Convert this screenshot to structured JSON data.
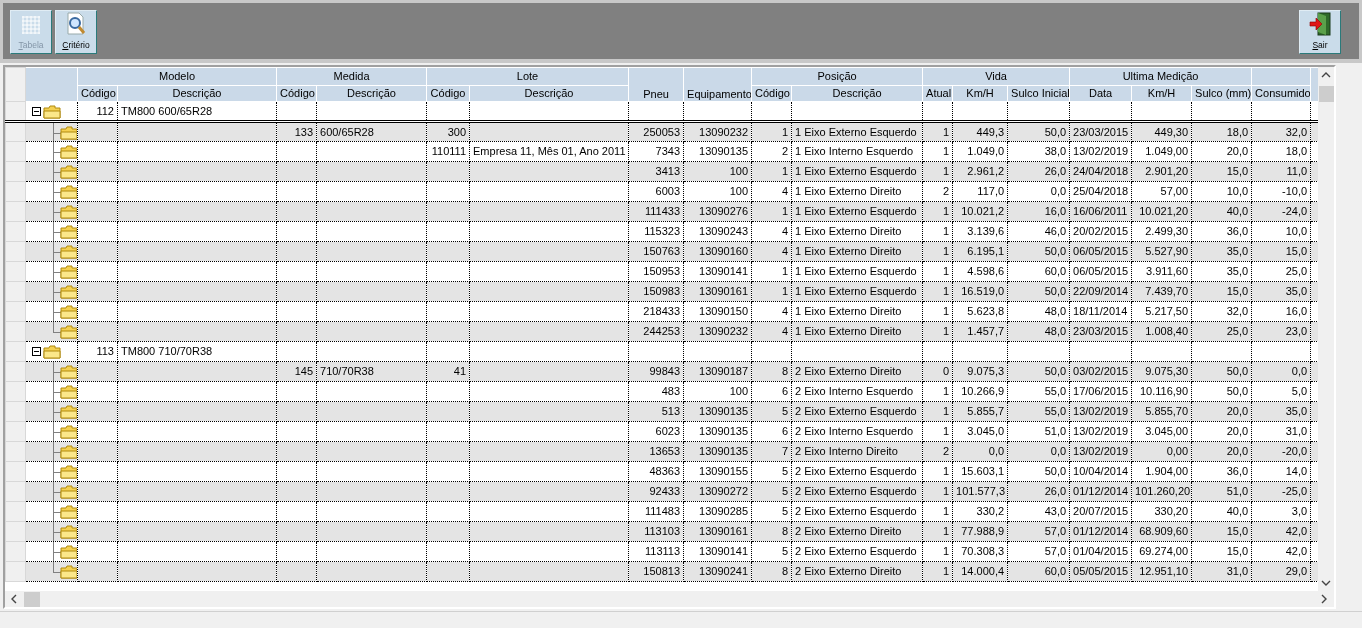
{
  "toolbar": {
    "buttons": [
      {
        "kind": "table",
        "label": "Tabela",
        "disabled": true
      },
      {
        "kind": "criteria",
        "label": "Critério",
        "disabled": false
      }
    ],
    "exit_button": {
      "label": "Sair"
    }
  },
  "table": {
    "header": [
      {
        "kind": "group",
        "label": "Modelo",
        "columns": [
          "Código",
          "Descrição"
        ]
      },
      {
        "kind": "group",
        "label": "Medida",
        "columns": [
          "Código",
          "Descrição"
        ]
      },
      {
        "kind": "group",
        "label": "Lote",
        "columns": [
          "Código",
          "Descrição"
        ]
      },
      {
        "kind": "single",
        "columns": [
          "Pneu"
        ]
      },
      {
        "kind": "single",
        "columns": [
          "Equipamento"
        ]
      },
      {
        "kind": "group",
        "label": "Posição",
        "columns": [
          "Código",
          "Descrição"
        ]
      },
      {
        "kind": "group",
        "label": "Vida",
        "columns": [
          "Atual",
          "Km/H",
          "Sulco Inicial"
        ]
      },
      {
        "kind": "group",
        "label": "Ultima Medição",
        "columns": [
          "Data",
          "Km/H",
          "Sulco (mm)"
        ]
      },
      {
        "kind": "group",
        "columns": [
          "Consumido"
        ]
      }
    ],
    "groups": [
      {
        "modelo_codigo": "112",
        "modelo_descricao": "TM800 600/65R28",
        "expanded": true,
        "current": true,
        "children": [
          {
            "medida_codigo": "133",
            "medida_descricao": "600/65R28",
            "lote_codigo": "300",
            "values": [
              "250053",
              "13090232",
              "1",
              "1 Eixo Externo Esquerdo",
              "1",
              "449,3",
              "50,0",
              "23/03/2015",
              "449,30",
              "18,0",
              "32,0"
            ]
          },
          {
            "lote_codigo": "110111",
            "lote_descricao": "Empresa 11, Mês 01, Ano 2011",
            "values": [
              "7343",
              "13090135",
              "2",
              "1 Eixo Interno Esquerdo",
              "1",
              "1.049,0",
              "38,0",
              "13/02/2019",
              "1.049,00",
              "20,0",
              "18,0"
            ]
          },
          {
            "values": [
              "3413",
              "100",
              "1",
              "1 Eixo Externo Esquerdo",
              "1",
              "2.961,2",
              "26,0",
              "24/04/2018",
              "2.901,20",
              "15,0",
              "11,0"
            ]
          },
          {
            "values": [
              "6003",
              "100",
              "4",
              "1 Eixo Externo Direito",
              "2",
              "117,0",
              "0,0",
              "25/04/2018",
              "57,00",
              "10,0",
              "-10,0"
            ]
          },
          {
            "values": [
              "111433",
              "13090276",
              "1",
              "1 Eixo Externo Esquerdo",
              "1",
              "10.021,2",
              "16,0",
              "16/06/2011",
              "10.021,20",
              "40,0",
              "-24,0"
            ]
          },
          {
            "values": [
              "115323",
              "13090243",
              "4",
              "1 Eixo Externo Direito",
              "1",
              "3.139,6",
              "46,0",
              "20/02/2015",
              "2.499,30",
              "36,0",
              "10,0"
            ]
          },
          {
            "values": [
              "150763",
              "13090160",
              "4",
              "1 Eixo Externo Direito",
              "1",
              "6.195,1",
              "50,0",
              "06/05/2015",
              "5.527,90",
              "35,0",
              "15,0"
            ]
          },
          {
            "values": [
              "150953",
              "13090141",
              "1",
              "1 Eixo Externo Esquerdo",
              "1",
              "4.598,6",
              "60,0",
              "06/05/2015",
              "3.911,60",
              "35,0",
              "25,0"
            ]
          },
          {
            "values": [
              "150983",
              "13090161",
              "1",
              "1 Eixo Externo Esquerdo",
              "1",
              "16.519,0",
              "50,0",
              "22/09/2014",
              "7.439,70",
              "15,0",
              "35,0"
            ]
          },
          {
            "values": [
              "218433",
              "13090150",
              "4",
              "1 Eixo Externo Direito",
              "1",
              "5.623,8",
              "48,0",
              "18/11/2014",
              "5.217,50",
              "32,0",
              "16,0"
            ]
          },
          {
            "values": [
              "244253",
              "13090232",
              "4",
              "1 Eixo Externo Direito",
              "1",
              "1.457,7",
              "48,0",
              "23/03/2015",
              "1.008,40",
              "25,0",
              "23,0"
            ]
          }
        ]
      },
      {
        "modelo_codigo": "113",
        "modelo_descricao": "TM800 710/70R38",
        "expanded": true,
        "current": false,
        "children": [
          {
            "medida_codigo": "145",
            "medida_descricao": "710/70R38",
            "lote_codigo": "41",
            "values": [
              "99843",
              "13090187",
              "8",
              "2 Eixo Externo Direito",
              "0",
              "9.075,3",
              "50,0",
              "03/02/2015",
              "9.075,30",
              "50,0",
              "0,0"
            ]
          },
          {
            "values": [
              "483",
              "100",
              "6",
              "2 Eixo Interno Esquerdo",
              "1",
              "10.266,9",
              "55,0",
              "17/06/2015",
              "10.116,90",
              "50,0",
              "5,0"
            ]
          },
          {
            "values": [
              "513",
              "13090135",
              "5",
              "2 Eixo Externo Esquerdo",
              "1",
              "5.855,7",
              "55,0",
              "13/02/2019",
              "5.855,70",
              "20,0",
              "35,0"
            ]
          },
          {
            "values": [
              "6023",
              "13090135",
              "6",
              "2 Eixo Interno Esquerdo",
              "1",
              "3.045,0",
              "51,0",
              "13/02/2019",
              "3.045,00",
              "20,0",
              "31,0"
            ]
          },
          {
            "values": [
              "13653",
              "13090135",
              "7",
              "2 Eixo Interno Direito",
              "2",
              "0,0",
              "0,0",
              "13/02/2019",
              "0,00",
              "20,0",
              "-20,0"
            ]
          },
          {
            "values": [
              "48363",
              "13090155",
              "5",
              "2 Eixo Externo Esquerdo",
              "1",
              "15.603,1",
              "50,0",
              "10/04/2014",
              "1.904,00",
              "36,0",
              "14,0"
            ]
          },
          {
            "values": [
              "92433",
              "13090272",
              "5",
              "2 Eixo Externo Esquerdo",
              "1",
              "101.577,3",
              "26,0",
              "01/12/2014",
              "101.260,20",
              "51,0",
              "-25,0"
            ]
          },
          {
            "values": [
              "111483",
              "13090285",
              "5",
              "2 Eixo Externo Esquerdo",
              "1",
              "330,2",
              "43,0",
              "20/07/2015",
              "330,20",
              "40,0",
              "3,0"
            ]
          },
          {
            "values": [
              "113103",
              "13090161",
              "8",
              "2 Eixo Externo Direito",
              "1",
              "77.988,9",
              "57,0",
              "01/12/2014",
              "68.909,60",
              "15,0",
              "42,0"
            ]
          },
          {
            "values": [
              "113113",
              "13090141",
              "5",
              "2 Eixo Externo Esquerdo",
              "1",
              "70.308,3",
              "57,0",
              "01/04/2015",
              "69.274,00",
              "15,0",
              "42,0"
            ]
          },
          {
            "values": [
              "150813",
              "13090241",
              "8",
              "2 Eixo Externo Direito",
              "1",
              "14.000,4",
              "60,0",
              "05/05/2015",
              "12.951,10",
              "31,0",
              "29,0"
            ]
          }
        ]
      }
    ]
  }
}
